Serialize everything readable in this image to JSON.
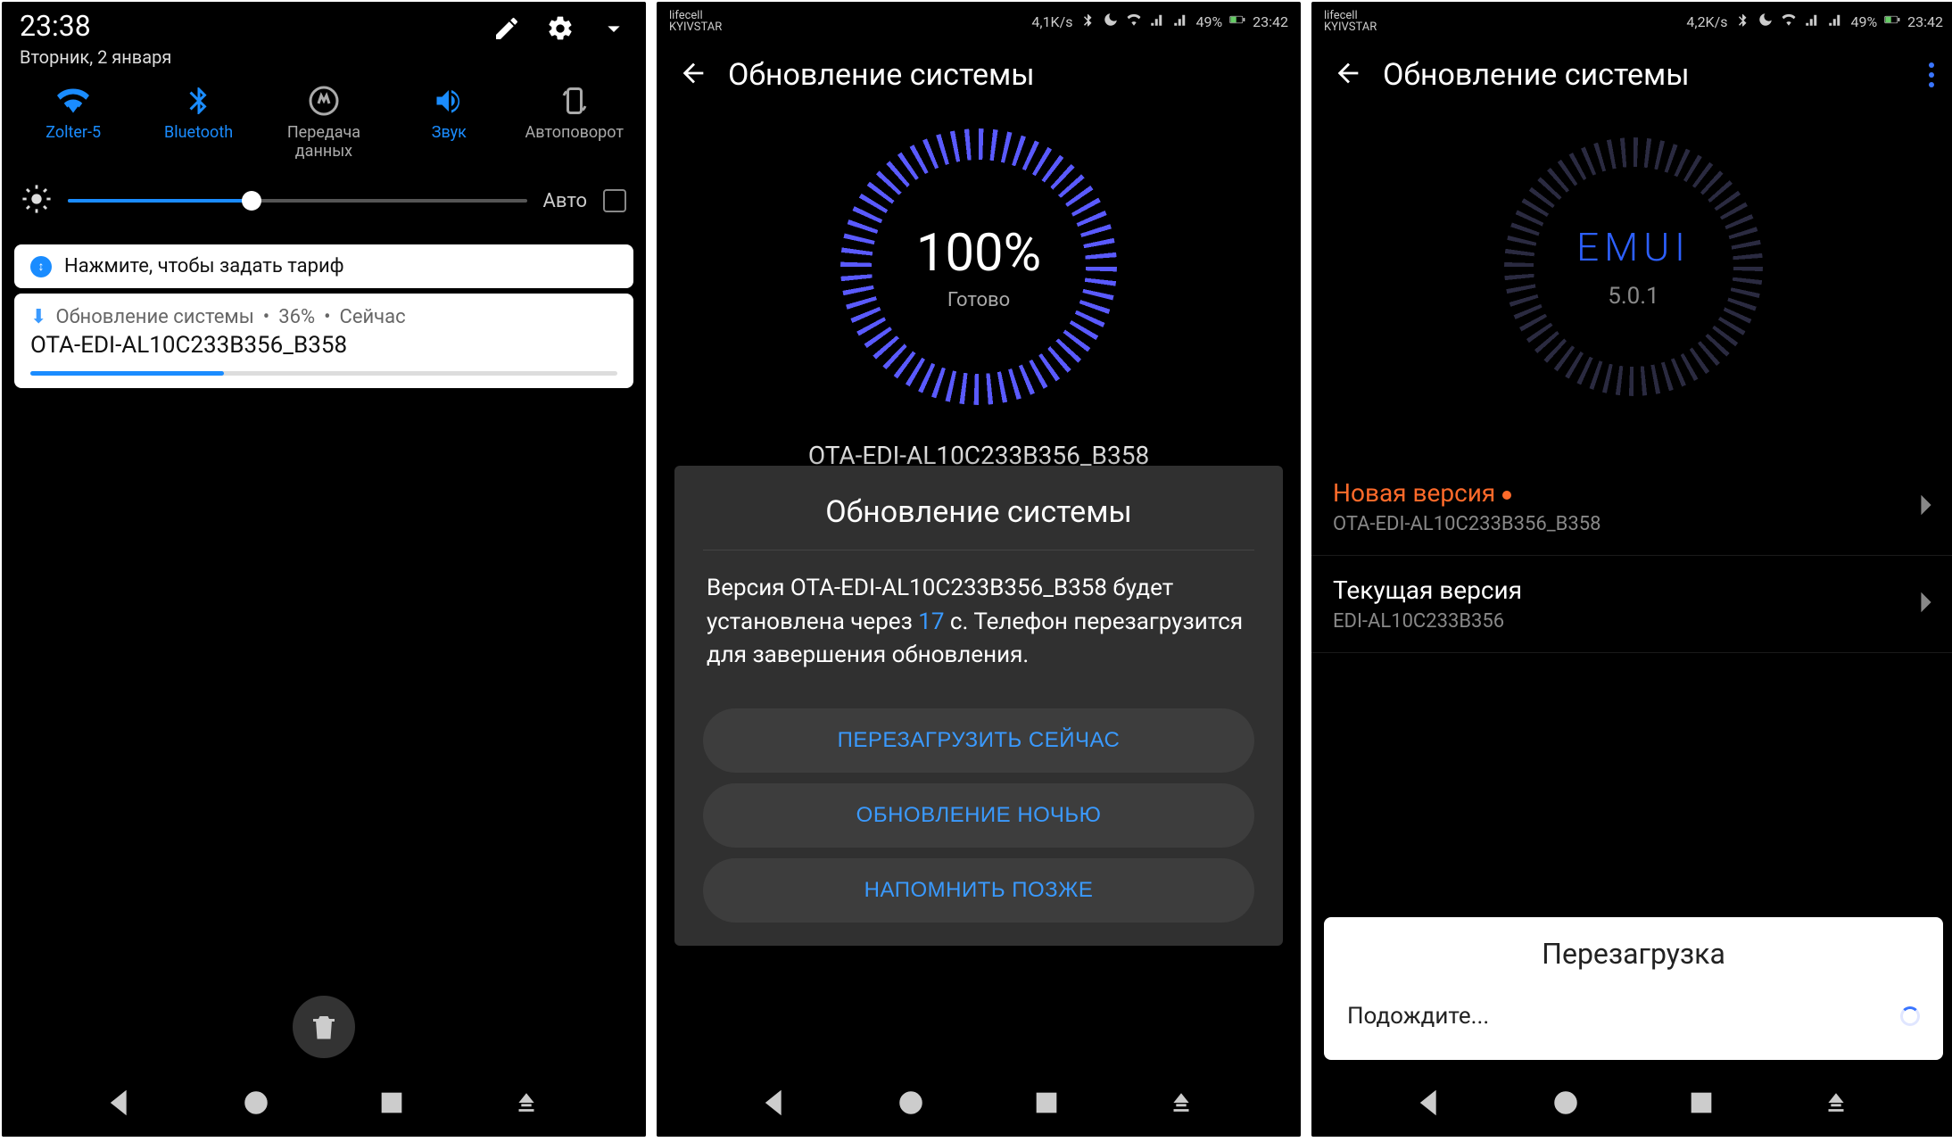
{
  "phone1": {
    "status": {
      "time": "23:38",
      "date": "Вторник, 2 января"
    },
    "qs": {
      "wifi": "Zolter-5",
      "bt": "Bluetooth",
      "data": "Передача данных",
      "sound": "Звук",
      "rotate": "Автоповорот"
    },
    "brightness": {
      "auto_label": "Авто"
    },
    "hint_text": "Нажмите, чтобы задать тариф",
    "notif": {
      "head_app": "Обновление системы",
      "head_pct": "36%",
      "head_time": "Сейчас",
      "body": "OTA-EDI-AL10C233B356_B358"
    }
  },
  "phone2": {
    "status": {
      "carrier_top": "lifecell",
      "carrier_bot": "KYIVSTAR",
      "speed": "4,1K/s",
      "battery": "49%",
      "time": "23:42"
    },
    "header_title": "Обновление системы",
    "ring": {
      "pct": "100%",
      "ready": "Готово"
    },
    "ota_name": "OTA-EDI-AL10C233B356_B358",
    "dialog": {
      "title": "Обновление системы",
      "body_pre": "Версия OTA-EDI-AL10C233B356_B358 будет установлена через ",
      "count": "17",
      "body_post": " с. Телефон перезагрузится для завершения обновления.",
      "btn_now": "ПЕРЕЗАГРУЗИТЬ СЕЙЧАС",
      "btn_night": "ОБНОВЛЕНИЕ НОЧЬЮ",
      "btn_later": "НАПОМНИТЬ ПОЗЖЕ"
    }
  },
  "phone3": {
    "status": {
      "carrier_top": "lifecell",
      "carrier_bot": "KYIVSTAR",
      "speed": "4,2K/s",
      "battery": "49%",
      "time": "23:42"
    },
    "header_title": "Обновление системы",
    "ring": {
      "brand": "EMUI",
      "ver": "5.0.1"
    },
    "new_version": {
      "title": "Новая версия",
      "value": "OTA-EDI-AL10C233B356_B358"
    },
    "cur_version": {
      "title": "Текущая версия",
      "value": "EDI-AL10C233B356"
    },
    "reboot": {
      "title": "Перезагрузка",
      "body": "Подождите..."
    }
  }
}
